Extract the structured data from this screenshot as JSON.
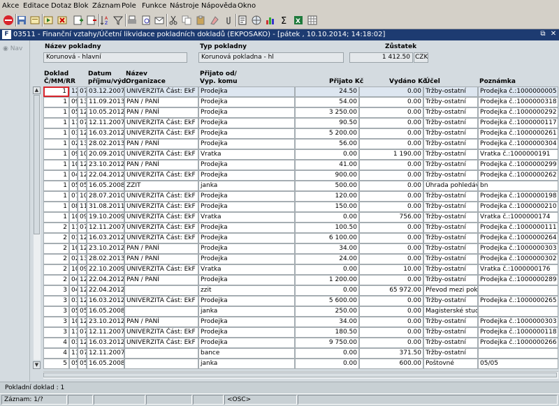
{
  "menu": [
    "Akce",
    "Editace",
    "Dotaz",
    "Blok",
    "Záznam",
    "Pole",
    "Funkce",
    "Nástroje",
    "Nápověda",
    "Okno"
  ],
  "toolbar": {
    "icons": [
      "exit-icon",
      "save-icon",
      "enter-query-icon",
      "execute-query-icon",
      "cancel-query-icon",
      "insert-record-icon",
      "delete-record-icon",
      "sort-icon",
      "filter-icon",
      "print-icon",
      "print-preview-icon",
      "email-icon",
      "cut-icon",
      "copy-icon",
      "paste-icon",
      "clear-icon",
      "attachment-icon",
      "document-icon",
      "web-icon",
      "chart-icon",
      "sum-icon",
      "excel-icon",
      "grid-icon"
    ]
  },
  "window": {
    "title": "03511 - Finanční vztahy/Účetní likvidace pokladních dokladů (EKPOSAKO) - [pátek , 10.10.2014; 14:18:02]",
    "logo": "F"
  },
  "nav": {
    "label": "Nav"
  },
  "header": {
    "cash_name_label": "Název pokladny",
    "cash_name_value": "Korunová - hlavní",
    "cash_type_label": "Typ pokladny",
    "cash_type_value": "Korunová pokladna - hl",
    "balance_label": "Zůstatek",
    "balance_value": "1 412.50",
    "currency": "CZK"
  },
  "columns": {
    "doklad": "Doklad\nČ/MM/RR",
    "datum": "Datum\npříjmu/výd.",
    "organizace": "Název\nOrganizace",
    "prijato_od": "Přijato od/\nVyp. komu",
    "prijato_kc": "Přijato Kč",
    "vydano_kc": "Vydáno Kč",
    "ucel": "Účel",
    "poznamka": "Poznámka"
  },
  "rows": [
    {
      "c": "1",
      "m": "12",
      "y": "07",
      "date": "03.12.2007",
      "org": "UNIVERZITA Část: EkF",
      "who": "Prodejka",
      "in": "24.50",
      "out": "0.00",
      "purpose": "Tržby-ostatní",
      "note": "Prodejka č.:1000000005"
    },
    {
      "c": "1",
      "m": "09",
      "y": "13",
      "date": "11.09.2013",
      "org": "PAN / PANÍ",
      "who": "Prodejka",
      "in": "54.00",
      "out": "0.00",
      "purpose": "Tržby-ostatní",
      "note": "Prodejka č.:1000000318"
    },
    {
      "c": "1",
      "m": "05",
      "y": "12",
      "date": "10.05.2012",
      "org": "PAN / PANÍ",
      "who": "Prodejka",
      "in": "3 250.00",
      "out": "0.00",
      "purpose": "Tržby-ostatní",
      "note": "Prodejka č.:1000000292"
    },
    {
      "c": "1",
      "m": "11",
      "y": "07",
      "date": "12.11.2007",
      "org": "UNIVERZITA Část: EkF",
      "who": "Prodejka",
      "in": "90.50",
      "out": "0.00",
      "purpose": "Tržby-ostatní",
      "note": "Prodejka č.:1000000117"
    },
    {
      "c": "1",
      "m": "03",
      "y": "12",
      "date": "16.03.2012",
      "org": "UNIVERZITA Část: EkF",
      "who": "Prodejka",
      "in": "5 200.00",
      "out": "0.00",
      "purpose": "Tržby-ostatní",
      "note": "Prodejka č.:1000000261"
    },
    {
      "c": "1",
      "m": "02",
      "y": "13",
      "date": "28.02.2013",
      "org": "PAN / PANÍ",
      "who": "Prodejka",
      "in": "56.00",
      "out": "0.00",
      "purpose": "Tržby-ostatní",
      "note": "Prodejka č.:1000000304"
    },
    {
      "c": "1",
      "m": "09",
      "y": "10",
      "date": "20.09.2010",
      "org": "UNIVERZITA Část: EkF",
      "who": "Vratka",
      "in": "0.00",
      "out": "1 190.00",
      "purpose": "Tržby-ostatní",
      "note": "Vratka č.:1000000191"
    },
    {
      "c": "1",
      "m": "10",
      "y": "12",
      "date": "23.10.2012",
      "org": "PAN / PANÍ",
      "who": "Prodejka",
      "in": "41.00",
      "out": "0.00",
      "purpose": "Tržby-ostatní",
      "note": "Prodejka č.:1000000299"
    },
    {
      "c": "1",
      "m": "04",
      "y": "12",
      "date": "22.04.2012",
      "org": "UNIVERZITA Část: EkF",
      "who": "Prodejka",
      "in": "900.00",
      "out": "0.00",
      "purpose": "Tržby-ostatní",
      "note": "Prodejka č.:1000000262"
    },
    {
      "c": "1",
      "m": "05",
      "y": "05",
      "date": "16.05.2008",
      "org": "ZZIT",
      "who": "janka",
      "in": "500.00",
      "out": "0.00",
      "purpose": "Úhrada pohledávky",
      "note": "bn"
    },
    {
      "c": "1",
      "m": "07",
      "y": "10",
      "date": "28.07.2010",
      "org": "UNIVERZITA Část: EkF",
      "who": "Prodejka",
      "in": "120.00",
      "out": "0.00",
      "purpose": "Tržby-ostatní",
      "note": "Prodejka č.:1000000198"
    },
    {
      "c": "1",
      "m": "08",
      "y": "11",
      "date": "31.08.2011",
      "org": "UNIVERZITA Část: EkF",
      "who": "Prodejka",
      "in": "150.00",
      "out": "0.00",
      "purpose": "Tržby-ostatní",
      "note": "Prodejka č.:1000000210"
    },
    {
      "c": "1",
      "m": "10",
      "y": "09",
      "date": "19.10.2009",
      "org": "UNIVERZITA Část: EkF",
      "who": "Vratka",
      "in": "0.00",
      "out": "756.00",
      "purpose": "Tržby-ostatní",
      "note": "Vratka č.:1000000174"
    },
    {
      "c": "2",
      "m": "11",
      "y": "07",
      "date": "12.11.2007",
      "org": "UNIVERZITA Část: EkF",
      "who": "Prodejka",
      "in": "100.50",
      "out": "0.00",
      "purpose": "Tržby-ostatní",
      "note": "Prodejka č.:1000000111"
    },
    {
      "c": "2",
      "m": "03",
      "y": "12",
      "date": "16.03.2012",
      "org": "UNIVERZITA Část: EkF",
      "who": "Prodejka",
      "in": "6 100.00",
      "out": "0.00",
      "purpose": "Tržby-ostatní",
      "note": "Prodejka č.:1000000264"
    },
    {
      "c": "2",
      "m": "10",
      "y": "12",
      "date": "23.10.2012",
      "org": "PAN / PANÍ",
      "who": "Prodejka",
      "in": "34.00",
      "out": "0.00",
      "purpose": "Tržby-ostatní",
      "note": "Prodejka č.:1000000303"
    },
    {
      "c": "2",
      "m": "02",
      "y": "13",
      "date": "28.02.2013",
      "org": "PAN / PANÍ",
      "who": "Prodejka",
      "in": "24.00",
      "out": "0.00",
      "purpose": "Tržby-ostatní",
      "note": "Prodejka č.:1000000302"
    },
    {
      "c": "2",
      "m": "10",
      "y": "09",
      "date": "22.10.2009",
      "org": "UNIVERZITA Část: EkF",
      "who": "Vratka",
      "in": "0.00",
      "out": "10.00",
      "purpose": "Tržby-ostatní",
      "note": "Vratka č.:1000000176"
    },
    {
      "c": "2",
      "m": "04",
      "y": "12",
      "date": "22.04.2012",
      "org": "PAN / PANÍ",
      "who": "Prodejka",
      "in": "1 200.00",
      "out": "0.00",
      "purpose": "Tržby-ostatní",
      "note": "Prodejka č.:1000000289"
    },
    {
      "c": "3",
      "m": "04",
      "y": "12",
      "date": "22.04.2012",
      "org": "",
      "who": "zzit",
      "in": "0.00",
      "out": "65 972.00",
      "purpose": "Převod mezi poklad",
      "note": ""
    },
    {
      "c": "3",
      "m": "03",
      "y": "12",
      "date": "16.03.2012",
      "org": "UNIVERZITA Část: EkF",
      "who": "Prodejka",
      "in": "5 600.00",
      "out": "0.00",
      "purpose": "Tržby-ostatní",
      "note": "Prodejka č.:1000000265"
    },
    {
      "c": "3",
      "m": "05",
      "y": "05",
      "date": "16.05.2008",
      "org": "",
      "who": "janka",
      "in": "250.00",
      "out": "0.00",
      "purpose": "Magisterské studiur",
      "note": ""
    },
    {
      "c": "3",
      "m": "10",
      "y": "12",
      "date": "23.10.2012",
      "org": "PAN / PANÍ",
      "who": "Prodejka",
      "in": "34.00",
      "out": "0.00",
      "purpose": "Tržby-ostatní",
      "note": "Prodejka č.:1000000303"
    },
    {
      "c": "3",
      "m": "11",
      "y": "07",
      "date": "12.11.2007",
      "org": "UNIVERZITA Část: EkF",
      "who": "Prodejka",
      "in": "180.50",
      "out": "0.00",
      "purpose": "Tržby-ostatní",
      "note": "Prodejka č.:1000000118"
    },
    {
      "c": "4",
      "m": "03",
      "y": "12",
      "date": "16.03.2012",
      "org": "UNIVERZITA Část: EkF",
      "who": "Prodejka",
      "in": "9 750.00",
      "out": "0.00",
      "purpose": "Tržby-ostatní",
      "note": "Prodejka č.:1000000266"
    },
    {
      "c": "4",
      "m": "11",
      "y": "07",
      "date": "12.11.2007",
      "org": "",
      "who": "bance",
      "in": "0.00",
      "out": "371.50",
      "purpose": "Tržby-ostatní",
      "note": ""
    },
    {
      "c": "5",
      "m": "05",
      "y": "05",
      "date": "16.05.2008",
      "org": "",
      "who": "janka",
      "in": "0.00",
      "out": "600.00",
      "purpose": "Poštovné",
      "note": "05/05"
    }
  ],
  "status": {
    "message": "Pokladní doklad : 1",
    "record": "Záznam: 1/?",
    "mode": "<OSC>"
  }
}
